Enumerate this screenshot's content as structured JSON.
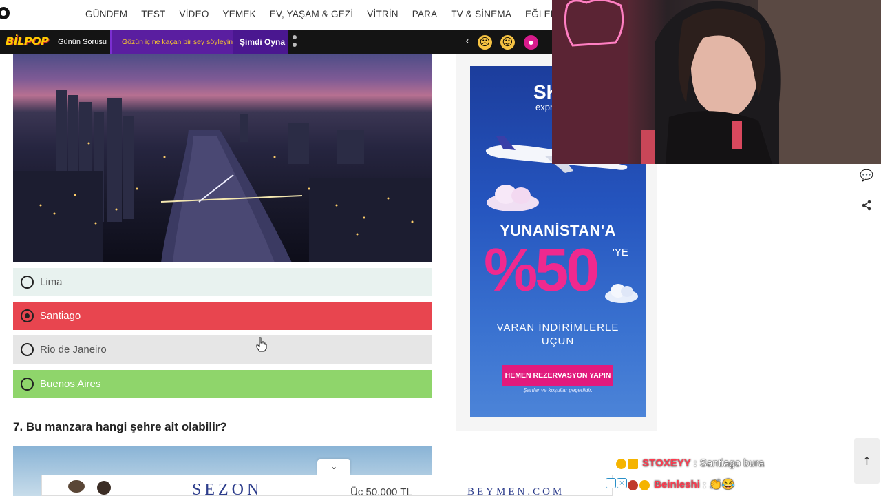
{
  "nav": {
    "items": [
      "GÜNDEM",
      "TEST",
      "VİDEO",
      "YEMEK",
      "EV, YAŞAM & GEZİ",
      "VİTRİN",
      "PARA",
      "TV & SİNEMA",
      "EĞLENCE"
    ]
  },
  "quizbar": {
    "logo": "BİLPOP",
    "label": "Günün Sorusu",
    "prompt": "Gözün içine kaçan bir şey söyleyin.",
    "play": "Şimdi Oyna",
    "reactions": [
      "sad-emoji",
      "smile-emoji",
      "badge-emoji"
    ]
  },
  "quiz": {
    "answers": [
      {
        "label": "Lima",
        "state": "neutral",
        "bg": "#e8f2ef",
        "color": "#555555"
      },
      {
        "label": "Santiago",
        "state": "selected-wrong",
        "bg": "#e8454f",
        "color": "#ffffff"
      },
      {
        "label": "Rio de Janeiro",
        "state": "neutral",
        "bg": "#e6e6e6",
        "color": "#555555"
      },
      {
        "label": "Buenos Aires",
        "state": "correct",
        "bg": "#8fd56b",
        "color": "#ffffff"
      }
    ],
    "next_question": "7. Bu manzara hangi şehre ait olabilir?"
  },
  "ad": {
    "brand": "SKY",
    "brand_sub": "express",
    "headline": "YUNANİSTAN'A",
    "percent": "%50",
    "suffix": "'YE",
    "sub_line1": "VARAN İNDİRİMLERLE",
    "sub_line2": "UÇUN",
    "cta": "HEMEN REZERVASYON YAPIN",
    "note": "Şartlar ve koşullar geçerlidir."
  },
  "chat": [
    {
      "user": "STOXEYY",
      "message": "Santiago bura"
    },
    {
      "user": "Beinleshi",
      "message": "👏😂"
    }
  ],
  "sticky_ad": {
    "title": "SEZON",
    "mid": "Üç 50.000 TL",
    "brand": "BEYMEN.COM"
  },
  "colors": {
    "accent_purple": "#5a1ea0",
    "wrong": "#e8454f",
    "correct": "#8fd56b",
    "ad_pink": "#e21a7d"
  }
}
